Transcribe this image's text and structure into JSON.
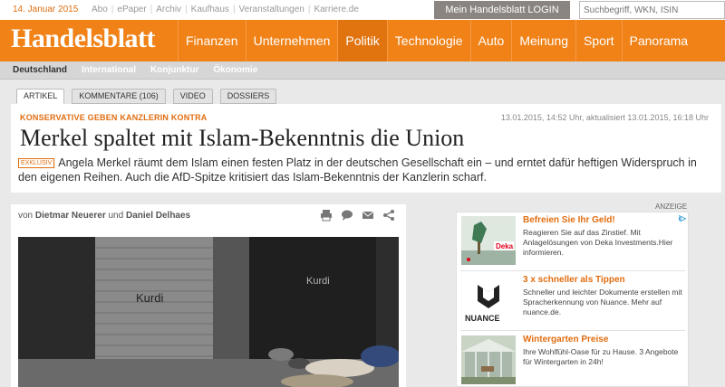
{
  "topbar": {
    "date": "14. Januar 2015",
    "links": [
      "Abo",
      "ePaper",
      "Archiv",
      "Kaufhaus",
      "Veranstaltungen",
      "Karriere.de"
    ],
    "login_label": "Mein Handelsblatt LOGIN",
    "search_placeholder": "Suchbegriff, WKN, ISIN"
  },
  "nav": {
    "logo": "Handelsblatt",
    "items": [
      "Finanzen",
      "Unternehmen",
      "Politik",
      "Technologie",
      "Auto",
      "Meinung",
      "Sport",
      "Panorama"
    ],
    "active": "Politik"
  },
  "subnav": {
    "items": [
      "Deutschland",
      "International",
      "Konjunktur",
      "Ökonomie"
    ],
    "active": "Deutschland"
  },
  "tabs": [
    "ARTIKEL",
    "KOMMENTARE (106)",
    "VIDEO",
    "DOSSIERS"
  ],
  "article": {
    "kicker": "KONSERVATIVE GEBEN KANZLERIN KONTRA",
    "timestamp": "13.01.2015, 14:52 Uhr, aktualisiert 13.01.2015, 16:18 Uhr",
    "headline": "Merkel spaltet mit Islam-Bekenntnis die Union",
    "badge": "EXKLUSIV",
    "teaser": "Angela Merkel räumt dem Islam einen festen Platz in der deutschen Gesellschaft ein – und erntet dafür heftigen Widerspruch in den eigenen Reihen. Auch die AfD-Spitze kritisiert das Islam-Bekenntnis der Kanzlerin scharf.",
    "byline_prefix": "von",
    "author1": "Dietmar Neuerer",
    "byline_and": "und",
    "author2": "Daniel Delhaes",
    "graffiti1": "Kurdi",
    "graffiti2": "Kurdi"
  },
  "ads": {
    "label": "ANZEIGE",
    "info_icon": "i▷",
    "items": [
      {
        "title": "Befreien Sie Ihr Geld!",
        "text": "Reagieren Sie auf das Zinstief. Mit Anlagelösungen von Deka Investments.Hier informieren.",
        "brand": "Deka"
      },
      {
        "title": "3 x schneller als Tippen",
        "text": "Schneller und leichter Dokumente erstellen mit Spracherkennung von Nuance. Mehr auf nuance.de.",
        "brand": "NUANCE"
      },
      {
        "title": "Wintergarten Preise",
        "text": "Ihre Wohlfühl-Oase für zu Hause. 3 Angebote für Wintergarten in 24h!"
      }
    ]
  },
  "colors": {
    "brand_orange": "#f08218",
    "accent_text": "#e06d10"
  }
}
